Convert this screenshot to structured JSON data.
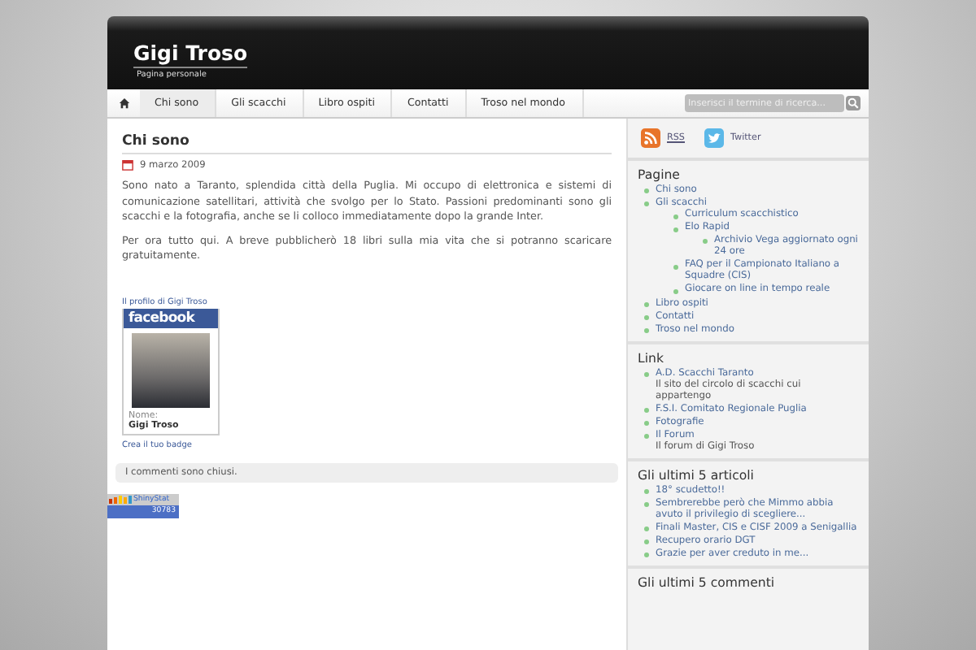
{
  "header": {
    "title": "Gigi Troso",
    "tagline": "Pagina personale"
  },
  "nav": {
    "items": [
      {
        "label": "Chi sono",
        "selected": true
      },
      {
        "label": "Gli scacchi",
        "selected": false
      },
      {
        "label": "Libro ospiti",
        "selected": false
      },
      {
        "label": "Contatti",
        "selected": false
      },
      {
        "label": "Troso nel mondo",
        "selected": false
      }
    ],
    "search": {
      "placeholder": "Inserisci il termine di ricerca..."
    }
  },
  "post": {
    "title": "Chi sono",
    "date": "9 marzo 2009",
    "paragraphs": [
      "Sono nato a Taranto, splendida città della Puglia. Mi occupo di elettronica e sistemi di comunicazione satellitari, attività che svolgo per lo Stato. Passioni predominanti sono gli scacchi e la fotografia, anche se li colloco immediatamente dopo la grande Inter.",
      "Per ora tutto qui. A breve pubblicherò 18 libri sulla mia vita che si potranno scaricare gratuitamente."
    ],
    "facebook_badge": {
      "profile_link": "Il profilo di Gigi Troso",
      "logo": "facebook",
      "name_label": "Nome:",
      "name": "Gigi Troso",
      "create_link": "Crea il tuo badge"
    },
    "comments_notice": "I commenti sono chiusi."
  },
  "counter": {
    "brand": "ShinyStat",
    "count": "30783"
  },
  "sidebar": {
    "feeds": [
      {
        "kind": "rss",
        "label": "RSS"
      },
      {
        "kind": "twitter",
        "label": "Twitter"
      }
    ],
    "pages": {
      "title": "Pagine",
      "items": [
        {
          "label": "Chi sono"
        },
        {
          "label": "Gli scacchi",
          "children": [
            {
              "label": "Curriculum scacchistico"
            },
            {
              "label": "Elo Rapid",
              "children": [
                {
                  "label": "Archivio Vega aggiornato ogni 24 ore"
                }
              ]
            },
            {
              "label": "FAQ per il Campionato Italiano a Squadre (CIS)"
            },
            {
              "label": "Giocare on line in tempo reale"
            }
          ]
        },
        {
          "label": "Libro ospiti"
        },
        {
          "label": "Contatti"
        },
        {
          "label": "Troso nel mondo"
        }
      ]
    },
    "links": {
      "title": "Link",
      "items": [
        {
          "name": "A.D. Scacchi Taranto",
          "description": "Il sito del circolo di scacchi cui appartengo"
        },
        {
          "name": "F.S.I. Comitato Regionale Puglia"
        },
        {
          "name": "Fotografie"
        },
        {
          "name": "Il Forum",
          "description": "Il forum di Gigi Troso"
        }
      ]
    },
    "recent_posts": {
      "title": "Gli ultimi 5 articoli",
      "items": [
        "18° scudetto!!",
        "Sembrerebbe però che Mimmo abbia avuto il privilegio di scegliere...",
        "Finali Master, CIS e CISF 2009 a Senigallia",
        "Recupero orario DGT",
        "Grazie per aver creduto in me..."
      ]
    },
    "recent_comments": {
      "title": "Gli ultimi 5 commenti"
    }
  }
}
